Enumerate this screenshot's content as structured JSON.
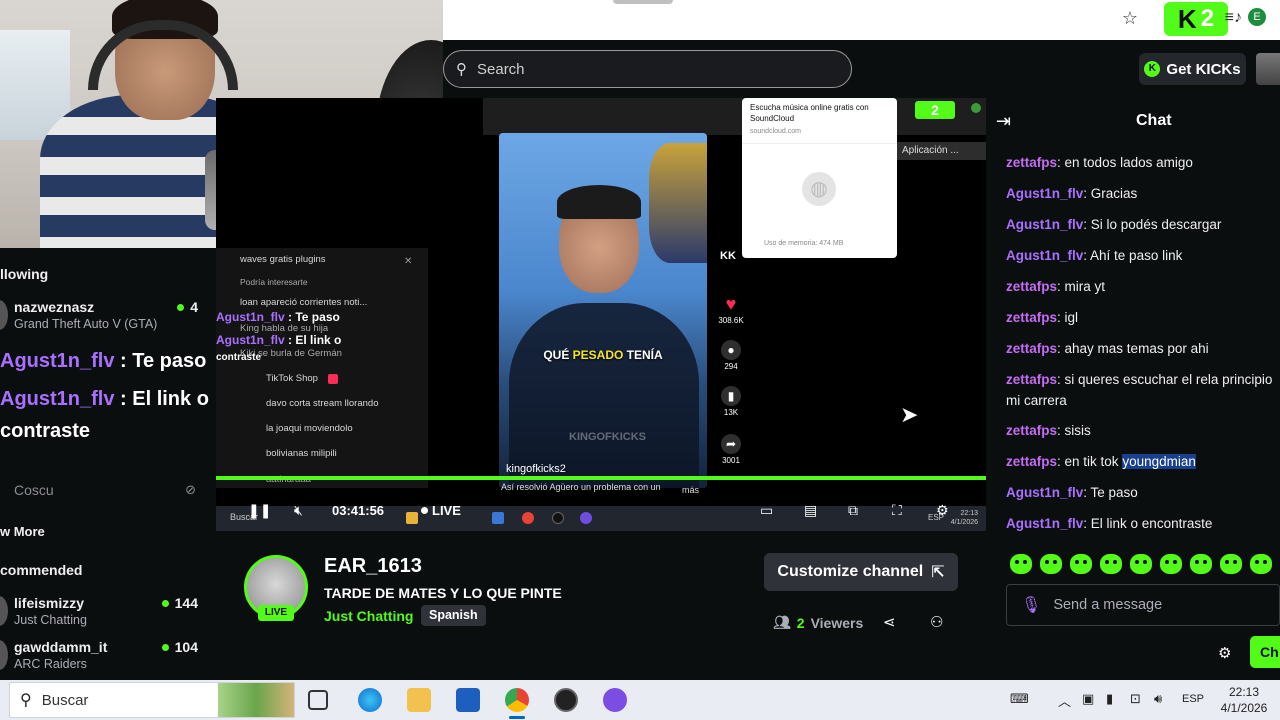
{
  "browser": {
    "ext_badge": "2",
    "profile_letter": "E"
  },
  "header": {
    "search_placeholder": "Search",
    "get_kicks": "Get KICKs"
  },
  "sidebar": {
    "following_label": "llowing",
    "following": [
      {
        "name": "nazweznasz",
        "game": "Grand Theft Auto V (GTA)",
        "viewers": "4"
      }
    ],
    "overlay_lines": [
      {
        "user": "Agust1n_flv",
        "text": " : Te paso"
      },
      {
        "user": "Agust1n_flv",
        "text": " : El link o"
      },
      {
        "user": "",
        "text": "contraste"
      }
    ],
    "offline_channel": "Coscu",
    "show_more": "w More",
    "recommended_label": "commended",
    "recommended": [
      {
        "name": "lifeismizzy",
        "game": "Just Chatting",
        "viewers": "144"
      },
      {
        "name": "gawddamm_it",
        "game": "ARC Raiders",
        "viewers": "104"
      }
    ]
  },
  "stream": {
    "inner_ext_badge": "2",
    "inner_tab": "Aplicación ...",
    "sound_popup": {
      "title": "Escucha música online gratis con SoundCloud",
      "url": "soundcloud.com",
      "memory": "Uso de memoria: 474 MB"
    },
    "bg_lines": [
      "waves gratis plugins",
      "Podría interesarte",
      "loan apareció corrientes noti...",
      "King habla de su hija",
      "Kiki se burla de Germán",
      "TikTok Shop",
      "davo corta stream llorando",
      "la joaqui moviendolo",
      "bolivianas milipili",
      "aatinaraaa"
    ],
    "bg_chat": [
      {
        "user": "Agust1n_flv",
        "text": ": Te paso"
      },
      {
        "user": "Agust1n_flv",
        "text": ": El link o"
      }
    ],
    "bg_prefix": "contraste",
    "caption_pre": "QUÉ ",
    "caption_hl": "PESADO",
    "caption_post": " TENÍA",
    "watermark": "KINGOFKICKS",
    "tt_actions": [
      {
        "icon": "heart",
        "count": "308.6K"
      },
      {
        "icon": "comment",
        "count": "294"
      },
      {
        "icon": "bookmark",
        "count": "13K"
      },
      {
        "icon": "share",
        "count": "3001"
      }
    ],
    "tt_brand": "KK",
    "tt_user": "kingofkicks2",
    "tt_desc": "Así resolvió Agüero un problema con un",
    "tt_more": "más",
    "time": "03:41:56",
    "live_label": "LIVE",
    "inner_search": "Buscar",
    "inner_lang": "ESP",
    "inner_clock": "22:13",
    "inner_date": "4/1/2026"
  },
  "channel": {
    "name": "EAR_1613",
    "title": "TARDE DE MATES Y LO QUE PINTE",
    "category": "Just Chatting",
    "language": "Spanish",
    "live_badge": "LIVE",
    "customize": "Customize channel",
    "viewers_count": "2",
    "viewers_label": "Viewers"
  },
  "chat": {
    "title": "Chat",
    "messages": [
      {
        "user": "zettafps",
        "color": "z",
        "text": "en todos lados amigo"
      },
      {
        "user": "Agust1n_flv",
        "color": "a",
        "text": "Gracias"
      },
      {
        "user": "Agust1n_flv",
        "color": "a",
        "text": "Si lo podés descargar"
      },
      {
        "user": "Agust1n_flv",
        "color": "a",
        "text": "Ahí te paso link"
      },
      {
        "user": "zettafps",
        "color": "z",
        "text": "mira yt"
      },
      {
        "user": "zettafps",
        "color": "z",
        "text": "igl"
      },
      {
        "user": "zettafps",
        "color": "z",
        "text": "ahay mas temas por ahi"
      },
      {
        "user": "zettafps",
        "color": "z",
        "text": "si queres escuchar el rela principio mi carrera"
      },
      {
        "user": "zettafps",
        "color": "z",
        "text": "sisis"
      },
      {
        "user": "zettafps",
        "color": "z",
        "text": "en tik tok ",
        "highlight": "youngdmian"
      },
      {
        "user": "Agust1n_flv",
        "color": "a",
        "text": "Te paso"
      },
      {
        "user": "Agust1n_flv",
        "color": "a",
        "text": "El link o encontraste"
      }
    ],
    "send_placeholder": "Send a message",
    "chat_button": "Ch"
  },
  "taskbar": {
    "search": "Buscar",
    "lang": "ESP",
    "time": "22:13",
    "date": "4/1/2026"
  },
  "colors": {
    "kick_green": "#53fc18",
    "purple": "#a970ff",
    "bg": "#0b0e0f"
  }
}
